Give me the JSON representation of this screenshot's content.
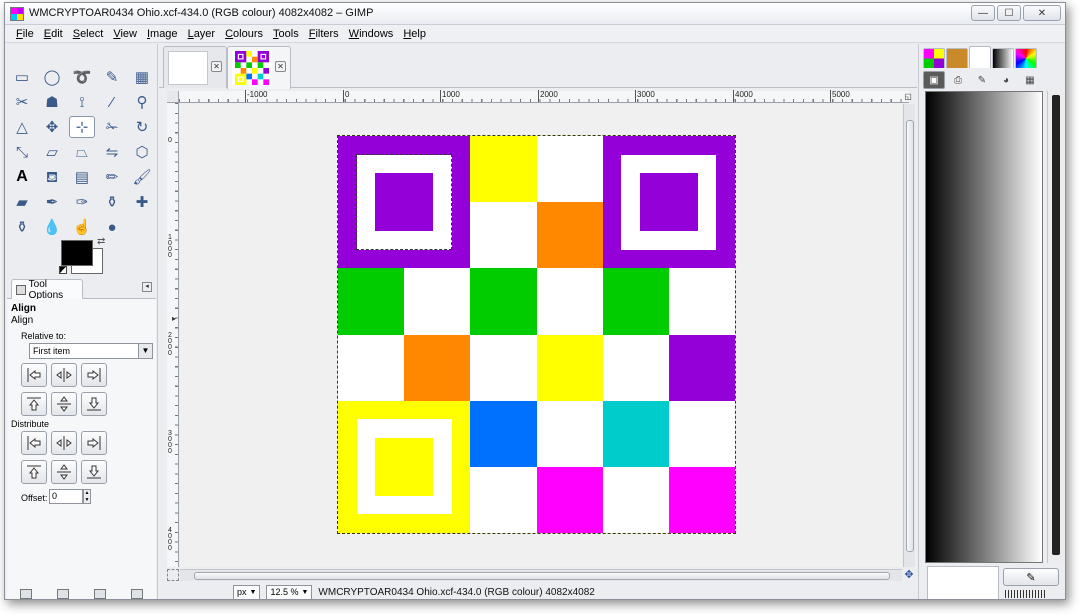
{
  "window": {
    "title": "WMCRYPTOAR0434 Ohio.xcf-434.0 (RGB colour) 4082x4082 – GIMP",
    "buttons": {
      "minimize": "—",
      "maximize": "☐",
      "close": "✕"
    }
  },
  "menubar": {
    "items": [
      "File",
      "Edit",
      "Select",
      "View",
      "Image",
      "Layer",
      "Colours",
      "Tools",
      "Filters",
      "Windows",
      "Help"
    ]
  },
  "toolbox": {
    "tools": [
      {
        "name": "rect-select",
        "glyph": "▭"
      },
      {
        "name": "ellipse-select",
        "glyph": "◯"
      },
      {
        "name": "free-select",
        "glyph": "➰"
      },
      {
        "name": "fuzzy-select",
        "glyph": "✎"
      },
      {
        "name": "select-by-color",
        "glyph": "▦"
      },
      {
        "name": "scissors-select",
        "glyph": "✂"
      },
      {
        "name": "foreground-select",
        "glyph": "☗"
      },
      {
        "name": "paths",
        "glyph": "⟟"
      },
      {
        "name": "color-picker",
        "glyph": "⁄"
      },
      {
        "name": "zoom",
        "glyph": "⚲"
      },
      {
        "name": "measure",
        "glyph": "△"
      },
      {
        "name": "move",
        "glyph": "✥"
      },
      {
        "name": "align",
        "glyph": "⊹"
      },
      {
        "name": "crop",
        "glyph": "✁"
      },
      {
        "name": "rotate",
        "glyph": "↻"
      },
      {
        "name": "scale",
        "glyph": "⤡"
      },
      {
        "name": "shear",
        "glyph": "▱"
      },
      {
        "name": "perspective",
        "glyph": "⏢"
      },
      {
        "name": "flip",
        "glyph": "⇋"
      },
      {
        "name": "cage",
        "glyph": "⬡"
      },
      {
        "name": "text",
        "glyph": "A"
      },
      {
        "name": "bucket-fill",
        "glyph": "⛾"
      },
      {
        "name": "blend",
        "glyph": "▤"
      },
      {
        "name": "pencil",
        "glyph": "✏"
      },
      {
        "name": "paintbrush",
        "glyph": "🖌"
      },
      {
        "name": "eraser",
        "glyph": "▰"
      },
      {
        "name": "airbrush",
        "glyph": "✒"
      },
      {
        "name": "ink",
        "glyph": "✑"
      },
      {
        "name": "clone",
        "glyph": "⚱"
      },
      {
        "name": "heal",
        "glyph": "✚"
      },
      {
        "name": "perspective-clone",
        "glyph": "⚱"
      },
      {
        "name": "blur",
        "glyph": "💧"
      },
      {
        "name": "smudge",
        "glyph": "☝"
      },
      {
        "name": "dodge-burn",
        "glyph": "●"
      }
    ],
    "tool_options_tab": "Tool Options",
    "align": {
      "heading": "Align",
      "subheading": "Align",
      "relative_label": "Relative to:",
      "relative_value": "First item",
      "distribute_label": "Distribute",
      "offset_label": "Offset:",
      "offset_value": "0"
    }
  },
  "canvas": {
    "ruler_h": [
      "-1000",
      "0",
      "1000",
      "2000",
      "3000",
      "4000",
      "5000"
    ],
    "ruler_v": [
      "0",
      "1000",
      "2000",
      "3000",
      "4000"
    ],
    "image_colors": {
      "purple": "#9400d8",
      "yellow": "#ffff00",
      "orange": "#ff8800",
      "green": "#00cc00",
      "blue": "#0070ff",
      "cyan": "#00cccc",
      "magenta": "#ff00ff",
      "white": "#ffffff"
    },
    "grid": [
      [
        "finder-purple",
        "finder-purple",
        "yellow",
        "white",
        "finder-purple",
        "finder-purple"
      ],
      [
        "finder-purple",
        "finder-purple",
        "white",
        "orange",
        "finder-purple",
        "finder-purple"
      ],
      [
        "green",
        "white",
        "green",
        "white",
        "green",
        "white"
      ],
      [
        "white",
        "orange",
        "white",
        "yellow",
        "white",
        "purple"
      ],
      [
        "finder-yellow",
        "finder-yellow",
        "blue",
        "white",
        "cyan",
        "white"
      ],
      [
        "finder-yellow",
        "finder-yellow",
        "white",
        "magenta",
        "white",
        "magenta"
      ]
    ]
  },
  "statusbar": {
    "unit": "px",
    "zoom": "12.5 %",
    "info": "WMCRYPTOAR0434 Ohio.xcf-434.0 (RGB colour) 4082x4082"
  }
}
